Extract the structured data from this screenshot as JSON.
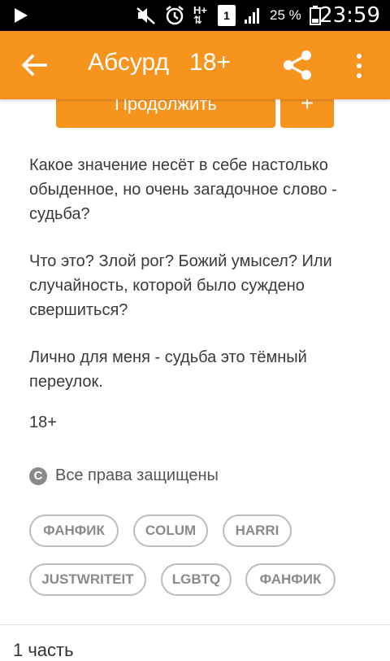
{
  "status_bar": {
    "battery_percent": "25 %",
    "time": "23:59",
    "network_type": "H+",
    "sim_slot": "1"
  },
  "app_bar": {
    "title": "Абсурд   18+"
  },
  "actions": {
    "continue_label": "Продолжить",
    "add_label": "+"
  },
  "description": {
    "paragraphs": [
      "Какое значение несёт в себе настолько обыденное, но очень загадочное слово - судьба?",
      "Что это? Злой рог? Божий умысел? Или случайность, которой было суждено свершиться?",
      "Лично для меня - судьба это тёмный переулок."
    ],
    "rating": "18+"
  },
  "copyright": {
    "icon_letter": "C",
    "text": "Все права защищены"
  },
  "tags": [
    "ФАНФИК",
    "COLUM",
    "HARRI",
    "JUSTWRITEIT",
    "LGBTQ",
    "ФАНФИК"
  ],
  "parts": {
    "label": "1 часть"
  },
  "colors": {
    "accent": "#f7941e",
    "status_bar": "#000000",
    "text": "#3a3a3a",
    "tag_border": "#bdbdbd",
    "tag_text": "#8a8a8a"
  }
}
